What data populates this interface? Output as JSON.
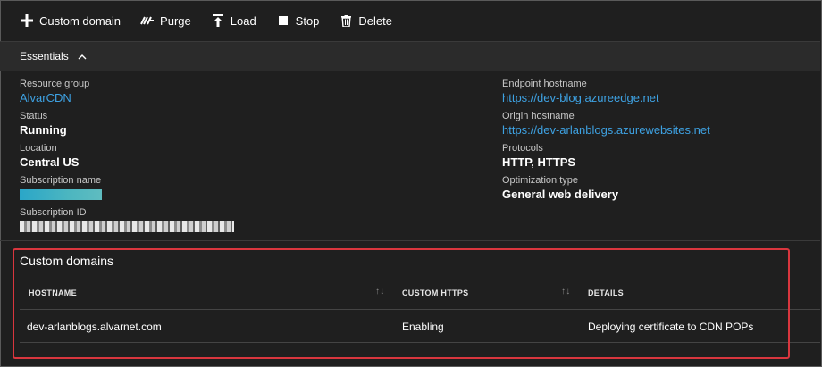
{
  "toolbar": {
    "custom_domain": "Custom domain",
    "purge": "Purge",
    "load": "Load",
    "stop": "Stop",
    "delete": "Delete"
  },
  "essentials": {
    "label": "Essentials"
  },
  "properties": {
    "resource_group": {
      "label": "Resource group",
      "value": "AlvarCDN"
    },
    "status": {
      "label": "Status",
      "value": "Running"
    },
    "location": {
      "label": "Location",
      "value": "Central US"
    },
    "subscription_name": {
      "label": "Subscription name"
    },
    "subscription_id": {
      "label": "Subscription ID"
    },
    "endpoint_hostname": {
      "label": "Endpoint hostname",
      "value": "https://dev-blog.azureedge.net"
    },
    "origin_hostname": {
      "label": "Origin hostname",
      "value": "https://dev-arlanblogs.azurewebsites.net"
    },
    "protocols": {
      "label": "Protocols",
      "value": "HTTP, HTTPS"
    },
    "optimization_type": {
      "label": "Optimization type",
      "value": "General web delivery"
    }
  },
  "custom_domains": {
    "title": "Custom domains",
    "columns": [
      "HOSTNAME",
      "CUSTOM HTTPS",
      "DETAILS"
    ],
    "sort_glyph": "↑↓",
    "rows": [
      {
        "hostname": "dev-arlanblogs.alvarnet.com",
        "custom_https": "Enabling",
        "details": "Deploying certificate to CDN POPs"
      }
    ]
  },
  "colors": {
    "link": "#3ea2e3",
    "highlight": "#d9363e",
    "background": "#1f1f1f"
  },
  "icons": [
    "plus-icon",
    "purge-icon",
    "load-icon",
    "stop-icon",
    "trash-icon",
    "chevron-up-icon"
  ]
}
